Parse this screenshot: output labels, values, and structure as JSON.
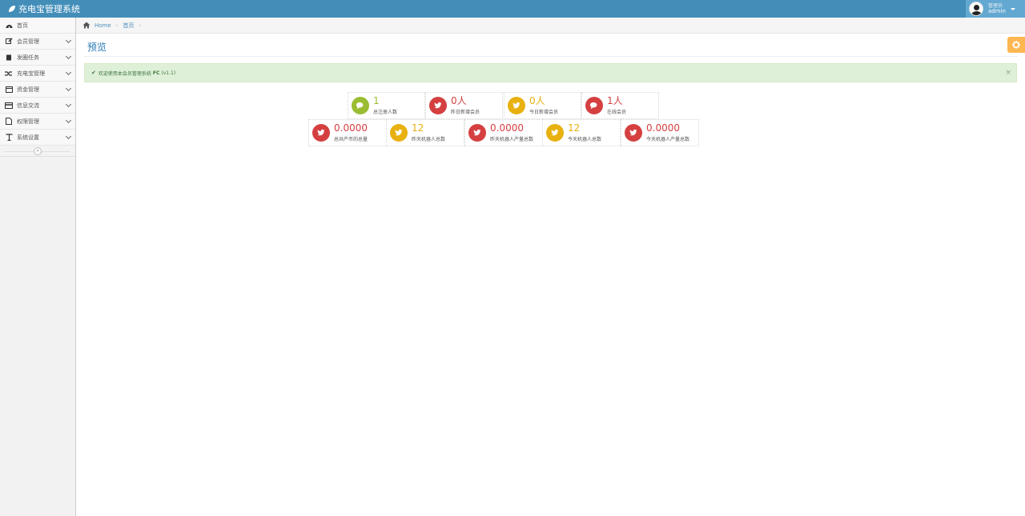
{
  "app": {
    "title": "充电宝管理系统"
  },
  "user": {
    "role": "管理员",
    "name": "admin"
  },
  "sidebar": {
    "items": [
      {
        "label": "首页",
        "icon": "dashboard-icon",
        "has_submenu": false
      },
      {
        "label": "会员管理",
        "icon": "edit-icon",
        "has_submenu": true
      },
      {
        "label": "发圈任务",
        "icon": "book-icon",
        "has_submenu": true
      },
      {
        "label": "充电宝管理",
        "icon": "random-icon",
        "has_submenu": true
      },
      {
        "label": "资金管理",
        "icon": "calendar-icon",
        "has_submenu": true
      },
      {
        "label": "信息交流",
        "icon": "card-icon",
        "has_submenu": true
      },
      {
        "label": "权限管理",
        "icon": "file-icon",
        "has_submenu": true
      },
      {
        "label": "系统设置",
        "icon": "text-icon",
        "has_submenu": true
      }
    ]
  },
  "breadcrumbs": {
    "home": "Home",
    "current": "首页"
  },
  "page": {
    "title": "预览"
  },
  "alert": {
    "text": "欢迎使用本会员管理系统",
    "strong": "FC",
    "version": "(v1.1)"
  },
  "stats": [
    {
      "value": "1",
      "label": "总注册人数",
      "color": "#9abc32",
      "icon": "comments-icon"
    },
    {
      "value": "0人",
      "label": "昨日新增会员",
      "color": "#d53f40",
      "icon": "twitter-icon"
    },
    {
      "value": "0人",
      "label": "今日新增会员",
      "color": "#e8b110",
      "icon": "twitter-icon"
    },
    {
      "value": "1人",
      "label": "在线会员",
      "color": "#d53f40",
      "icon": "comments-icon"
    },
    {
      "value": "0.0000",
      "label": "总共产币的总量",
      "color": "#d53f40",
      "icon": "twitter-icon"
    },
    {
      "value": "12",
      "label": "昨天机器人总数",
      "color": "#e8b110",
      "icon": "twitter-icon"
    },
    {
      "value": "0.0000",
      "label": "昨天机器人产量总数",
      "color": "#d53f40",
      "icon": "twitter-icon"
    },
    {
      "value": "12",
      "label": "今天机器人总数",
      "color": "#e8b110",
      "icon": "twitter-icon"
    },
    {
      "value": "0.0000",
      "label": "今天机器人产量总数",
      "color": "#d53f40",
      "icon": "twitter-icon"
    }
  ],
  "colors": {
    "navbar": "#438eb9",
    "user_box": "#62a8d1",
    "settings": "#ffb752",
    "alert_bg": "#dff0d8"
  }
}
